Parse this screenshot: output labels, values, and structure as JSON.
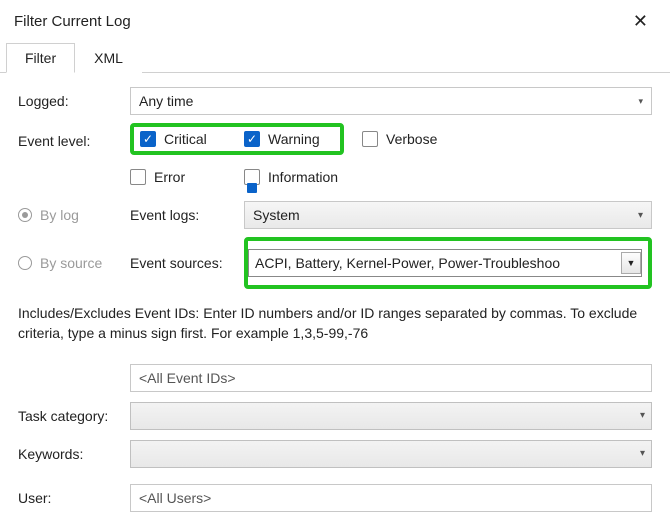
{
  "dialog": {
    "title": "Filter Current Log"
  },
  "tabs": {
    "filter": "Filter",
    "xml": "XML"
  },
  "labels": {
    "logged": "Logged:",
    "eventLevel": "Event level:",
    "byLog": "By log",
    "bySource": "By source",
    "eventLogs": "Event logs:",
    "eventSources": "Event sources:",
    "taskCategory": "Task category:",
    "keywords": "Keywords:",
    "user": "User:"
  },
  "loggedSelect": "Any time",
  "levels": {
    "critical": "Critical",
    "warning": "Warning",
    "verbose": "Verbose",
    "error": "Error",
    "information": "Information"
  },
  "eventLogsValue": "System",
  "eventSourcesValue": "ACPI, Battery, Kernel-Power, Power-Troubleshoo",
  "notes": "Includes/Excludes Event IDs: Enter ID numbers and/or ID ranges separated by commas. To exclude criteria, type a minus sign first. For example 1,3,5-99,-76",
  "eventIdsPlaceholder": "<All Event IDs>",
  "userPlaceholder": "<All Users>",
  "colors": {
    "highlight": "#22c321",
    "checkbox": "#0a63c9"
  }
}
